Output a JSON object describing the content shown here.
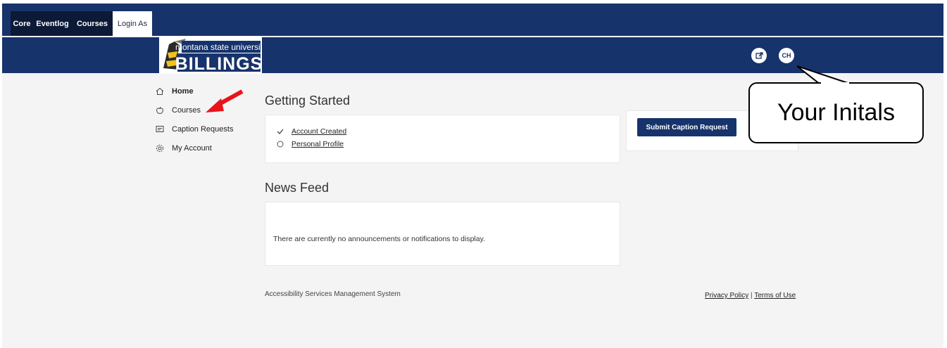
{
  "admin_tabs": [
    {
      "label": "Core"
    },
    {
      "label": "Eventlog"
    },
    {
      "label": "Courses"
    },
    {
      "label": "Login As"
    }
  ],
  "header": {
    "logo_line1": "montana state university",
    "logo_line2": "BILLINGS",
    "user_initials": "CH",
    "external_icon": "external-link-icon"
  },
  "sidebar": {
    "items": [
      {
        "label": "Home",
        "icon": "home-icon",
        "active": true
      },
      {
        "label": "Courses",
        "icon": "apple-icon",
        "active": false
      },
      {
        "label": "Caption Requests",
        "icon": "message-icon",
        "active": false
      },
      {
        "label": "My Account",
        "icon": "gear-icon",
        "active": false
      }
    ]
  },
  "getting_started": {
    "title": "Getting Started",
    "items": [
      {
        "label": "Account Created",
        "done": true
      },
      {
        "label": "Personal Profile",
        "done": false
      }
    ]
  },
  "actions": {
    "submit_label": "Submit Caption Request"
  },
  "news_feed": {
    "title": "News Feed",
    "empty_message": "There are currently no announcements or notifications to display."
  },
  "footer": {
    "system_name": "Accessibility Services Management System",
    "privacy": "Privacy Policy",
    "separator": "|",
    "terms": "Terms of Use"
  },
  "annotation": {
    "callout_text": "Your Initals"
  },
  "colors": {
    "brand_navy": "#17336b",
    "annotation_arrow": "#e8141b"
  }
}
